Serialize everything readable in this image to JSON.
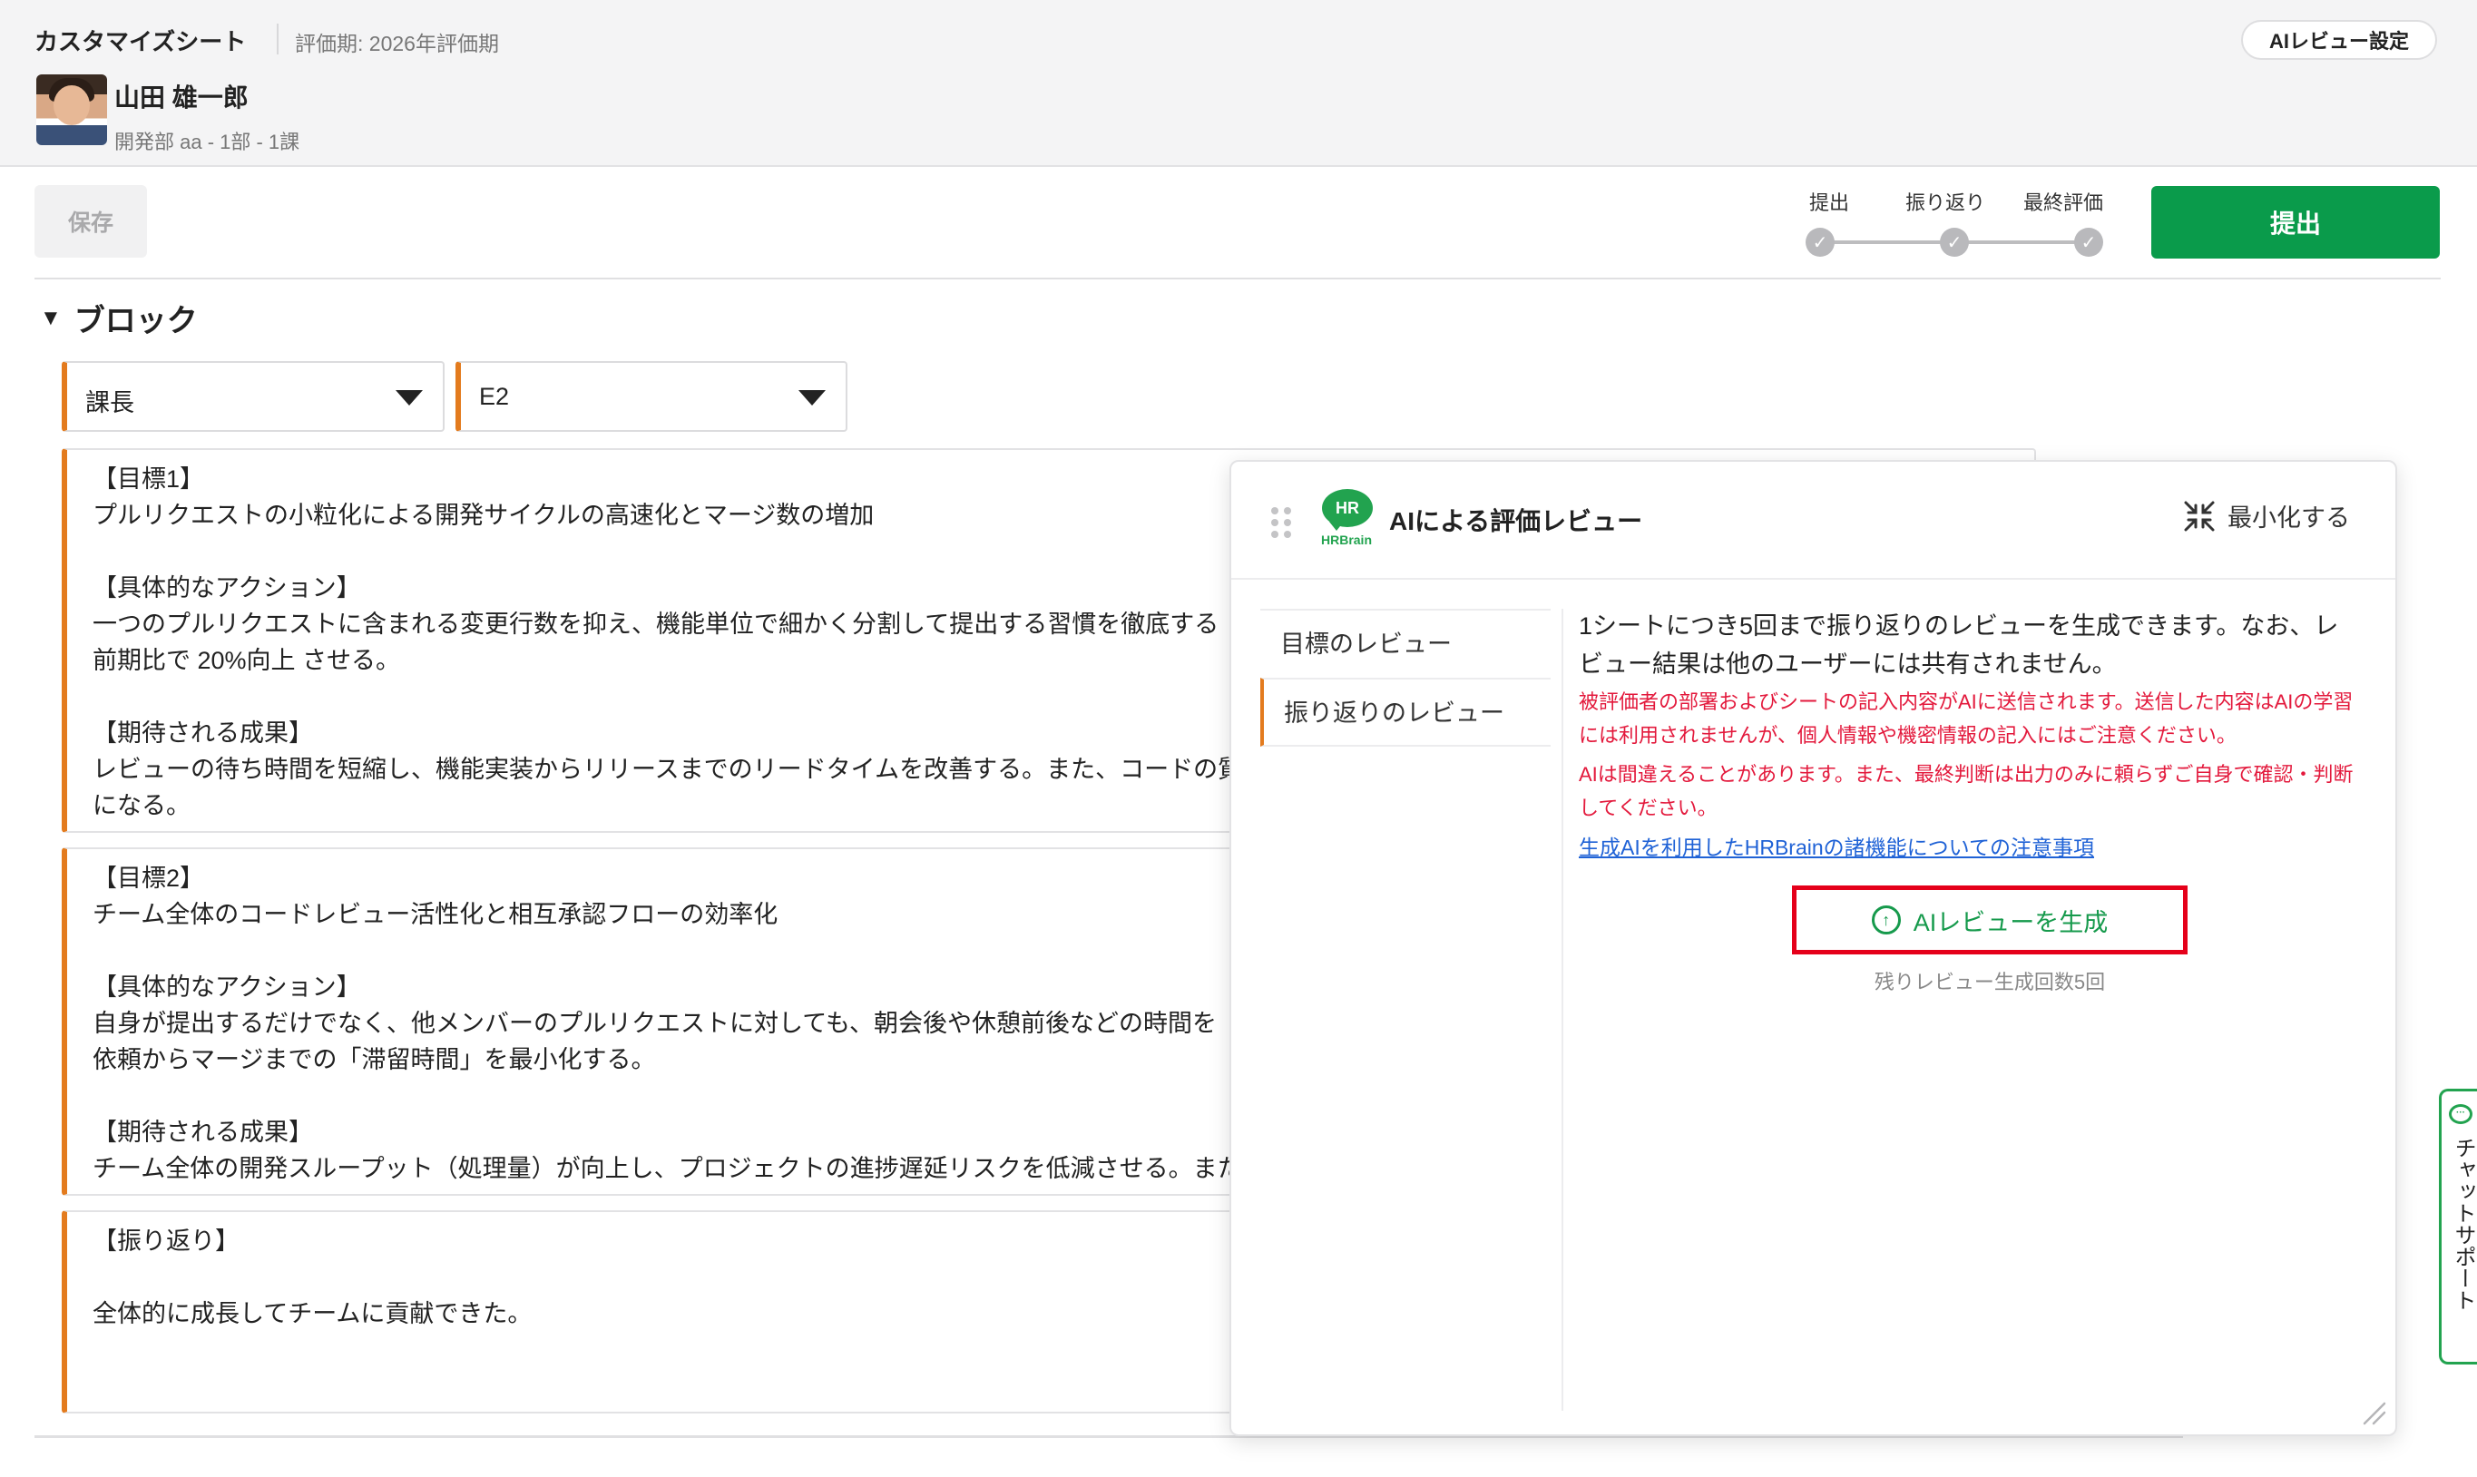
{
  "header": {
    "sheet_title": "カスタマイズシート",
    "period": "評価期: 2026年評価期",
    "ai_review_setting_label": "AIレビュー設定",
    "user_name": "山田 雄一郎",
    "user_dept": "開発部 aa - 1部 - 1課"
  },
  "toolbar": {
    "save_label": "保存",
    "submit_label": "提出",
    "steps": [
      {
        "label": "提出",
        "state": "done"
      },
      {
        "label": "振り返り",
        "state": "done"
      },
      {
        "label": "最終評価",
        "state": "done"
      }
    ],
    "check_glyph": "✓"
  },
  "block": {
    "title": "ブロック",
    "toggle_glyph": "▼",
    "selects": [
      {
        "value": "課長"
      },
      {
        "value": "E2"
      }
    ],
    "cards": [
      {
        "text": "【目標1】\nプルリクエストの小粒化による開発サイクルの高速化とマージ数の増加\n\n【具体的なアクション】\n一つのプルリクエストに含まれる変更行数を抑え、機能単位で細かく分割して提出する習慣を徹底する\n前期比で 20%向上 させる。\n\n【期待される成果】\nレビューの待ち時間を短縮し、機能実装からリリースまでのリードタイムを改善する。また、コードの質\nになる。"
      },
      {
        "text": "【目標2】\nチーム全体のコードレビュー活性化と相互承認フローの効率化\n\n【具体的なアクション】\n自身が提出するだけでなく、他メンバーのプルリクエストに対しても、朝会後や休憩前後などの時間を\n依頼からマージまでの「滞留時間」を最小化する。\n\n【期待される成果】\nチーム全体の開発スループット（処理量）が向上し、プロジェクトの進捗遅延リスクを低減させる。また"
      },
      {
        "text": "【振り返り】\n\n全体的に成長してチームに貢献できた。"
      }
    ]
  },
  "ai_panel": {
    "logo_text": "HR",
    "logo_brand": "HRBrain",
    "title": "AIによる評価レビュー",
    "minimize_label": "最小化する",
    "nav": [
      {
        "label": "目標のレビュー",
        "active": false
      },
      {
        "label": "振り返りのレビュー",
        "active": true
      }
    ],
    "intro": "1シートにつき5回まで振り返りのレビューを生成できます。なお、レビュー結果は他のユーザーには共有されません。",
    "warning_1": "被評価者の部署およびシートの記入内容がAIに送信されます。送信した内容はAIの学習には利用されませんが、個人情報や機密情報の記入にはご注意ください。",
    "warning_2": "AIは間違えることがあります。また、最終判断は出力のみに頼らずご自身で確認・判断してください。",
    "link_text": "生成AIを利用したHRBrainの諸機能についての注意事項",
    "generate_label": "AIレビューを生成",
    "generate_icon_glyph": "↑",
    "remaining_text": "残りレビュー生成回数5回"
  },
  "chat_support": {
    "icon_glyph": "···",
    "label": "チャットサポート"
  },
  "colors": {
    "accent_orange": "#e37b1e",
    "brand_green": "#0a9b4b",
    "warning_red": "#e3193c",
    "link_blue": "#1f62d6",
    "highlight_red": "#e5001a"
  }
}
